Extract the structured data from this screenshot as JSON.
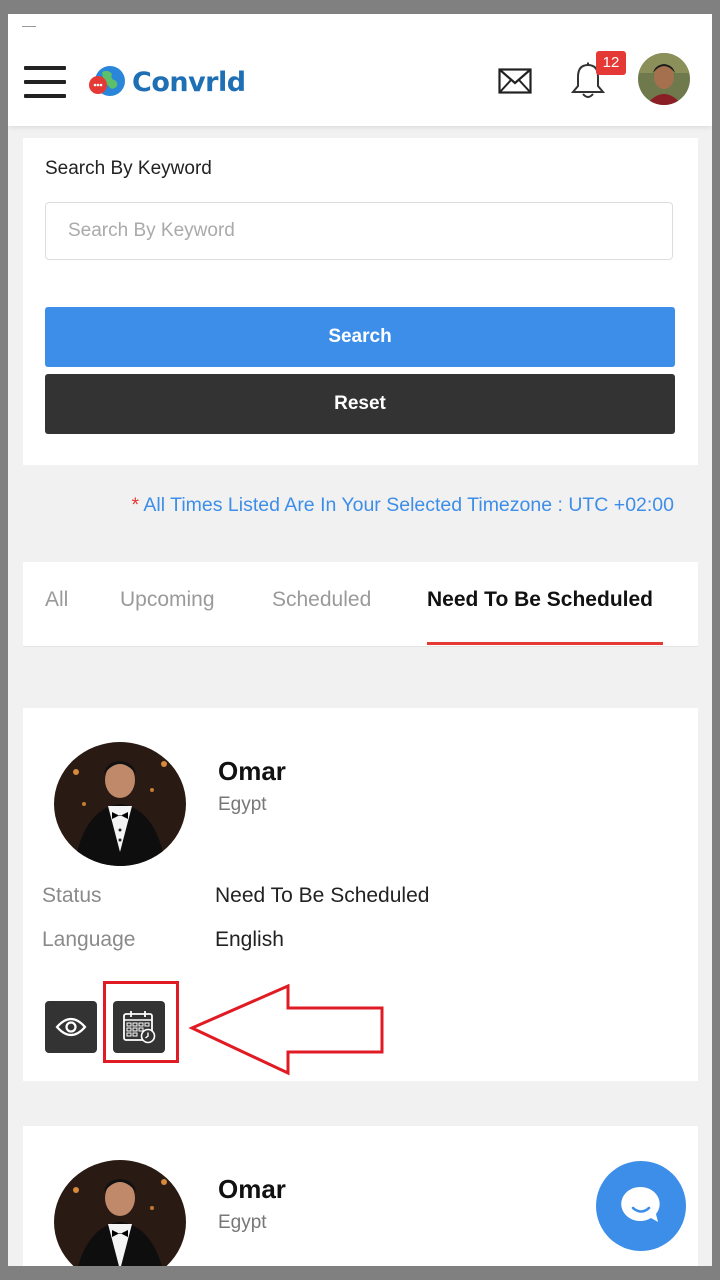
{
  "header": {
    "logo_text": "Convrld",
    "notification_count": "12",
    "icons": [
      "menu-icon",
      "globe-logo-icon",
      "mail-icon",
      "bell-icon",
      "avatar"
    ]
  },
  "search": {
    "label": "Search By Keyword",
    "placeholder": "Search By Keyword",
    "value": "",
    "search_button": "Search",
    "reset_button": "Reset"
  },
  "timezone": {
    "star": "*",
    "text": "All Times Listed Are In Your Selected Timezone : UTC +02:00"
  },
  "tabs": [
    {
      "label": "All",
      "active": false
    },
    {
      "label": "Upcoming",
      "active": false
    },
    {
      "label": "Scheduled",
      "active": false
    },
    {
      "label": "Need To Be Scheduled",
      "active": true
    }
  ],
  "sessions": [
    {
      "name": "Omar",
      "country": "Egypt",
      "status_label": "Status",
      "status_value": "Need To Be Scheduled",
      "language_label": "Language",
      "language_value": "English",
      "actions": [
        "eye-icon",
        "calendar-clock-icon"
      ]
    },
    {
      "name": "Omar",
      "country": "Egypt"
    }
  ],
  "colors": {
    "primary_blue": "#3d8ee9",
    "dark": "#333333",
    "accent_red": "#e53935",
    "annotation_red": "#e01b24",
    "logo_blue": "#1f6fb5"
  }
}
